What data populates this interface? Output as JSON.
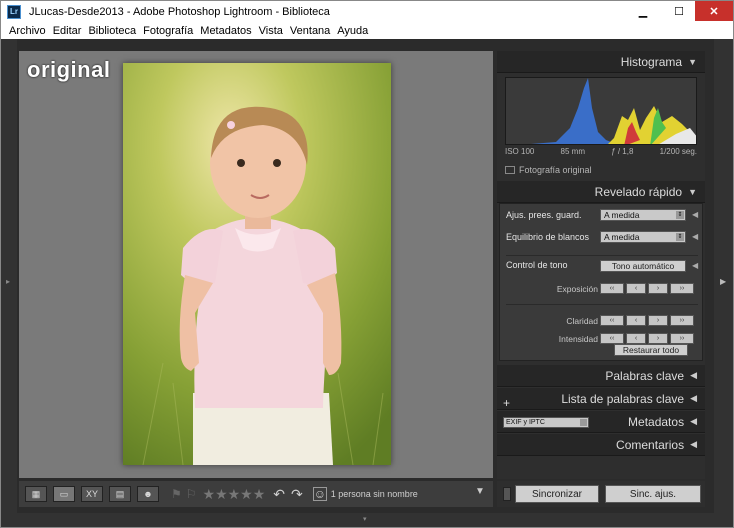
{
  "window": {
    "app_icon": "Lr",
    "title": "JLucas-Desde2013 - Adobe Photoshop Lightroom - Biblioteca",
    "minimize_glyph": "▁",
    "maximize_glyph": "☐",
    "close_glyph": "✕"
  },
  "menubar": {
    "items": [
      "Archivo",
      "Editar",
      "Biblioteca",
      "Fotografía",
      "Metadatos",
      "Vista",
      "Ventana",
      "Ayuda"
    ]
  },
  "canvas": {
    "photo_label": "original"
  },
  "toolbar": {
    "view_grid_glyph": "▦",
    "view_loupe_glyph": "▭",
    "view_compare_label": "XY",
    "view_survey_glyph": "▤",
    "view_people_glyph": "☻",
    "stars": "★★★★★",
    "people_label": "1 persona sin nombre"
  },
  "panel": {
    "histogram": {
      "title": "Histograma",
      "iso": "ISO 100",
      "focal": "85 mm",
      "aperture": "ƒ / 1,8",
      "shutter": "1/200 seg.",
      "original_photo_label": "Fotografía original"
    },
    "quick_develop": {
      "title": "Revelado rápido",
      "preset_label": "Ajus. prees. guard.",
      "preset_value": "A medida",
      "wb_label": "Equilibrio de blancos",
      "wb_value": "A medida",
      "tone_label": "Control de tono",
      "auto_tone_label": "Tono automático",
      "exposure_label": "Exposición",
      "clarity_label": "Claridad",
      "vibrance_label": "Intensidad",
      "step_glyphs": [
        "‹‹",
        "‹",
        "›",
        "››"
      ],
      "restore_label": "Restaurar todo"
    },
    "keywords_title": "Palabras clave",
    "keyword_list_title": "Lista de palabras clave",
    "metadata_title": "Metadatos",
    "metadata_preset": "EXIF y IPTC",
    "comments_title": "Comentarios"
  },
  "sync": {
    "sync_label": "Sincronizar",
    "sync_settings_label": "Sinc. ajus."
  }
}
